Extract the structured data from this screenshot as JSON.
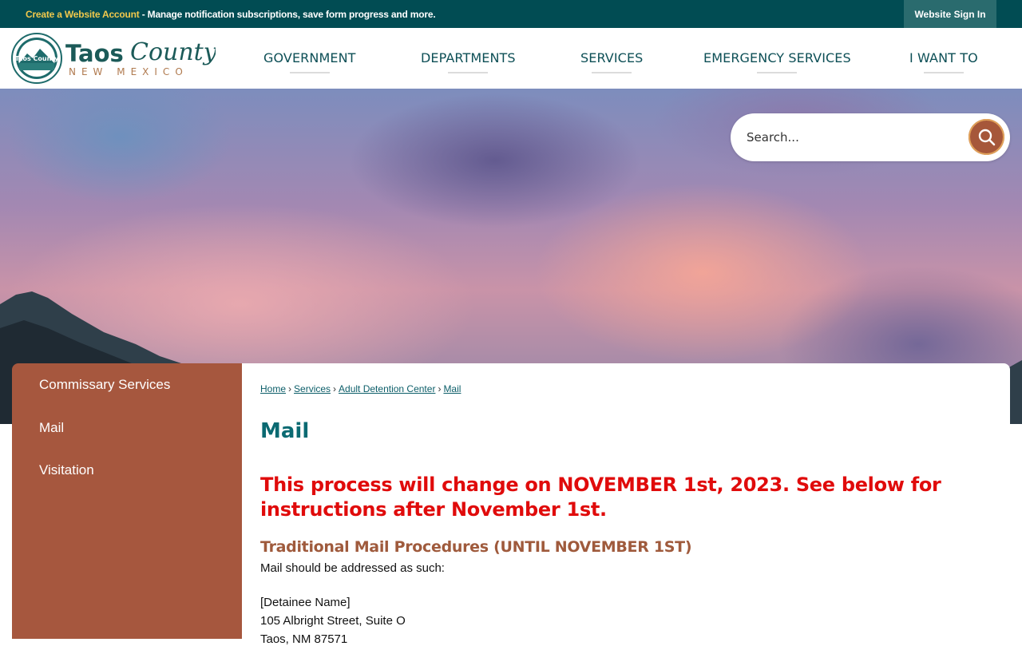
{
  "topbar": {
    "create_account_link": "Create a Website Account",
    "message": " - Manage notification subscriptions, save form progress and more.",
    "sign_in": "Website Sign In"
  },
  "logo": {
    "name_bold": "Taos",
    "name_script": "County",
    "state": "NEW MEXICO",
    "seal_text": "Taos County"
  },
  "nav": {
    "items": [
      {
        "label": "GOVERNMENT"
      },
      {
        "label": "DEPARTMENTS"
      },
      {
        "label": "SERVICES"
      },
      {
        "label": "EMERGENCY SERVICES"
      },
      {
        "label": "I WANT TO"
      }
    ]
  },
  "search": {
    "placeholder": "Search..."
  },
  "sidebar": {
    "items": [
      {
        "label": "Commissary Services"
      },
      {
        "label": "Mail"
      },
      {
        "label": "Visitation"
      }
    ]
  },
  "breadcrumb": {
    "items": [
      {
        "label": "Home"
      },
      {
        "label": "Services"
      },
      {
        "label": "Adult Detention Center"
      },
      {
        "label": "Mail"
      }
    ],
    "separator": "›"
  },
  "page": {
    "title": "Mail",
    "alert": "This process will change on NOVEMBER 1st, 2023. See below for instructions after November 1st.",
    "subheading": "Traditional Mail Procedures (UNTIL NOVEMBER 1ST)",
    "intro": "Mail should be addressed as such:",
    "address": [
      "[Detainee Name]",
      "105 Albright Street, Suite O",
      "Taos, NM 87571"
    ]
  },
  "colors": {
    "topbar": "#014c53",
    "nav_text": "#0d4f56",
    "sidebar": "#a6573e",
    "title": "#0b6a72",
    "alert": "#e00b0b",
    "subheading": "#9f5a3c"
  }
}
